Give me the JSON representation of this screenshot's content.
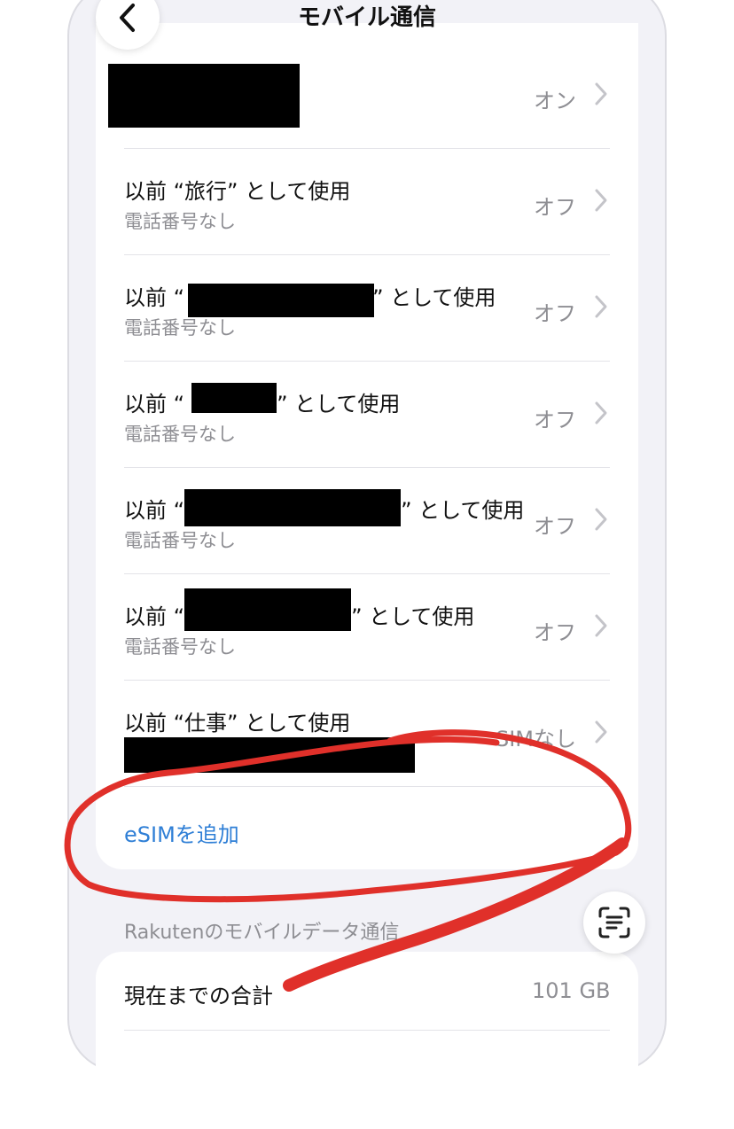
{
  "nav": {
    "title": "モバイル通信",
    "back_icon": "chevron-left-icon"
  },
  "sims": [
    {
      "title": "",
      "subtitle": "",
      "status": "オン"
    },
    {
      "title": "以前 “旅行” として使用",
      "subtitle": "電話番号なし",
      "status": "オフ"
    },
    {
      "title_prefix": "以前 “",
      "title_suffix": "” として使用",
      "subtitle": "電話番号なし",
      "status": "オフ"
    },
    {
      "title_prefix": "以前 “",
      "title_suffix": "” として使用",
      "subtitle": "電話番号なし",
      "status": "オフ"
    },
    {
      "title_prefix": "以前 “",
      "title_suffix": "” として使用",
      "subtitle": "電話番号なし",
      "status": "オフ"
    },
    {
      "title_prefix": "以前 “",
      "title_suffix": "” として使用",
      "subtitle": "電話番号なし",
      "status": "オフ"
    },
    {
      "title": "以前 “仕事” として使用",
      "subtitle": "",
      "status": "SIMなし"
    }
  ],
  "add_esim_label": "eSIMを追加",
  "data_section": {
    "header": "Rakutenのモバイルデータ通信",
    "rows": [
      {
        "label": "現在までの合計",
        "value": "101 GB"
      }
    ]
  },
  "scan_icon": "text-scan-icon",
  "colors": {
    "link": "#2f7fd6",
    "annotation": "#e0302a",
    "background": "#f2f2f7"
  }
}
